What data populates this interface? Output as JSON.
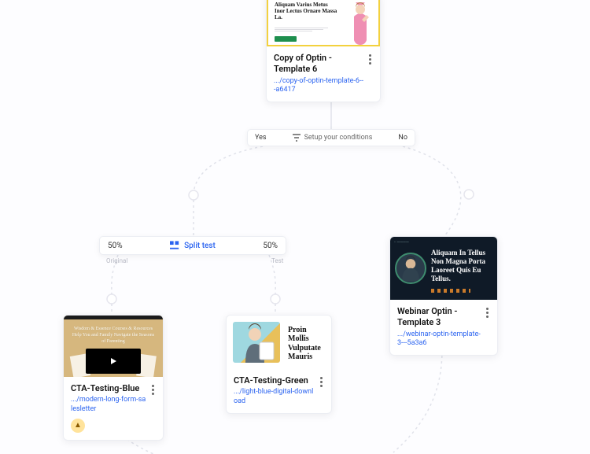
{
  "nodes": {
    "top": {
      "title": "Copy of Optin - Template 6",
      "url": ".../copy-of-optin-template-6---a6417",
      "thumb_heading": "Aliquam Varius Metus Inor Lectus Ornare Massa La."
    },
    "condition": {
      "yes_label": "Yes",
      "no_label": "No",
      "center_label": "Setup your conditions"
    },
    "split": {
      "left_pct": "50%",
      "right_pct": "50%",
      "center_label": "Split test",
      "left_sub": "Original",
      "right_sub": "Test"
    },
    "cta_blue": {
      "title": "CTA-Testing-Blue",
      "url": ".../modern-long-form-salesletter",
      "thumb_heading": "Wisdom & Essence Courses & Resources Help You and Family Navigate the Seasons of Parenting"
    },
    "cta_green": {
      "title": "CTA-Testing-Green",
      "url": ".../light-blue-digital-download",
      "thumb_caption": "",
      "thumb_heading": "Proin Mollis Vulputate Mauris"
    },
    "webinar": {
      "title": "Webinar Optin - Template 3",
      "url": ".../webinar-optin-template-3---5a3a6",
      "thumb_heading": "Aliquam In Tellus Non Magna Porta Laoreet Quis Eu Tellus."
    }
  }
}
